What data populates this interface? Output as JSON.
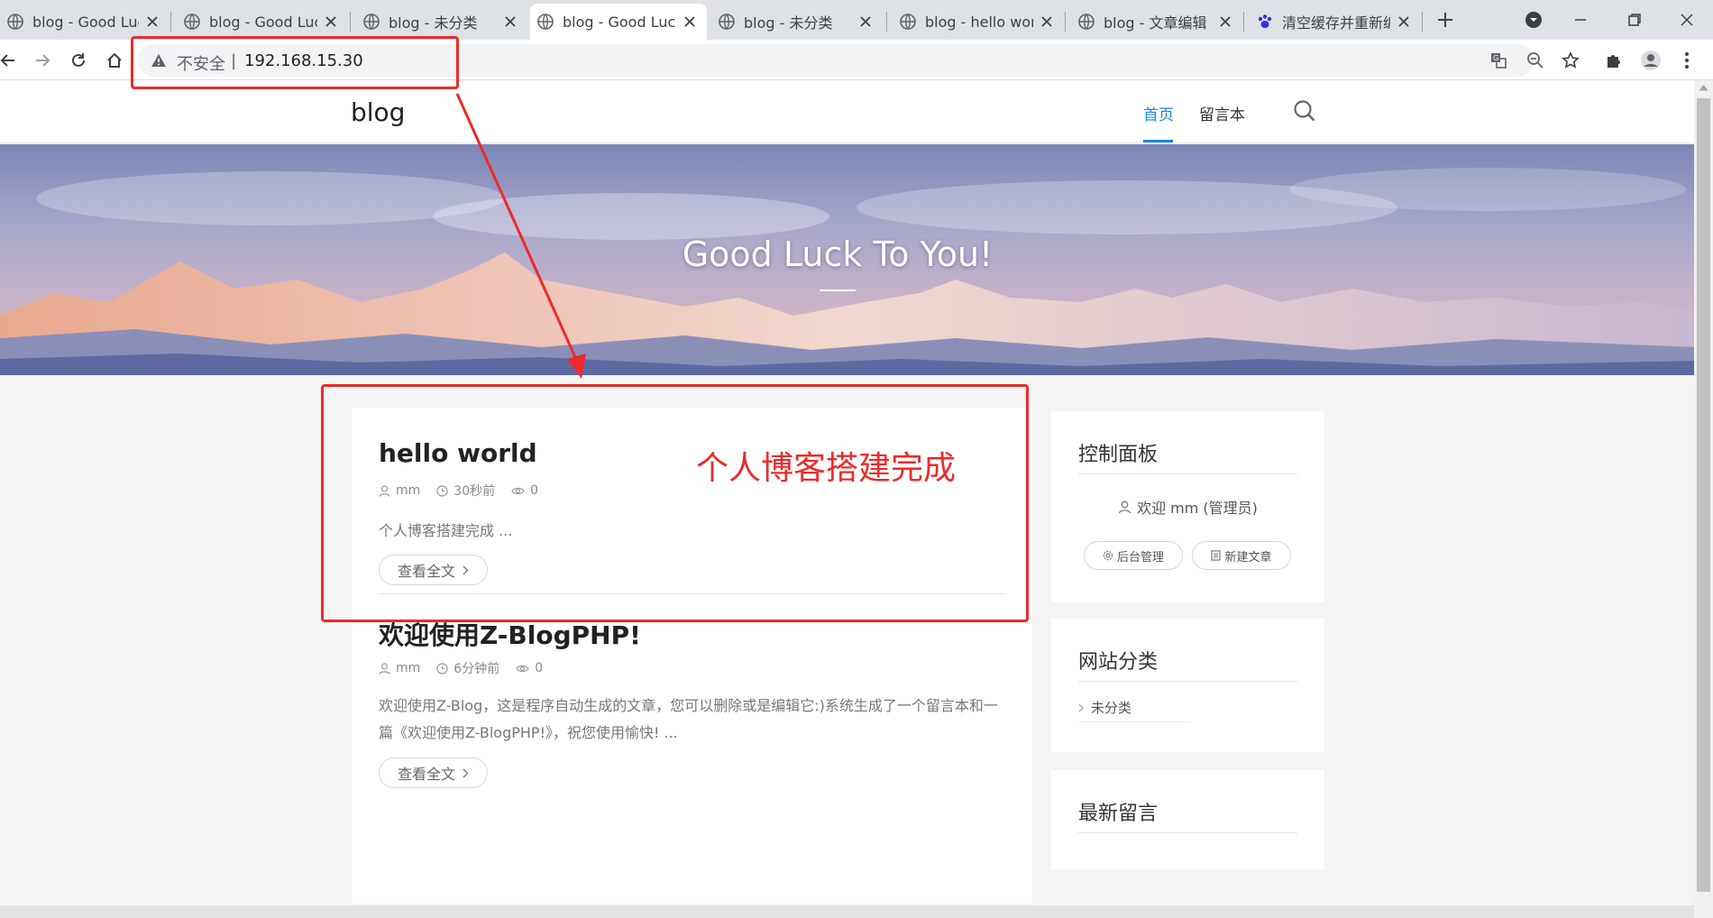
{
  "browser": {
    "tabs": [
      {
        "title": "blog - Good Luck To You!",
        "favicon": "globe-icon",
        "active": false
      },
      {
        "title": "blog - Good Luck To You!",
        "favicon": "globe-icon",
        "active": false
      },
      {
        "title": "blog - 未分类",
        "favicon": "globe-icon",
        "active": false
      },
      {
        "title": "blog - Good Luck To You!",
        "favicon": "globe-icon",
        "active": true
      },
      {
        "title": "blog - 未分类",
        "favicon": "globe-icon",
        "active": false
      },
      {
        "title": "blog - hello world",
        "favicon": "globe-icon",
        "active": false
      },
      {
        "title": "blog - 文章编辑",
        "favicon": "globe-icon",
        "active": false
      },
      {
        "title": "清空缓存并重新编译模板",
        "favicon": "paw-icon",
        "active": false
      }
    ],
    "address_bar": {
      "security_label": "不安全",
      "separator": "|",
      "url": "192.168.15.30"
    }
  },
  "site": {
    "logo": "blog",
    "nav": [
      {
        "label": "首页",
        "active": true
      },
      {
        "label": "留言本",
        "active": false
      }
    ],
    "banner_title": "Good Luck To You!"
  },
  "posts": [
    {
      "title": "hello world",
      "author": "mm",
      "time": "30秒前",
      "views": "0",
      "excerpt": "个人博客搭建完成 ...",
      "read_more": "查看全文"
    },
    {
      "title": "欢迎使用Z-BlogPHP!",
      "author": "mm",
      "time": "6分钟前",
      "views": "0",
      "excerpt_line1": "欢迎使用Z-Blog，这是程序自动生成的文章，您可以删除或是编辑它:)系统生成了一个留言本和一",
      "excerpt_line2": "篇《欢迎使用Z-BlogPHP!》，祝您使用愉快! ...",
      "read_more": "查看全文"
    }
  ],
  "sidebar": {
    "control_panel": {
      "title": "控制面板",
      "welcome": "欢迎 mm (管理员)",
      "admin_button": "后台管理",
      "new_post_button": "新建文章"
    },
    "categories": {
      "title": "网站分类",
      "items": [
        "未分类"
      ]
    },
    "recent_comments": {
      "title": "最新留言"
    }
  },
  "annotation": {
    "text": "个人博客搭建完成",
    "color": "#ee2a2a"
  },
  "colors": {
    "accent": "#1a86e6",
    "annotation": "#ee2a2a"
  }
}
